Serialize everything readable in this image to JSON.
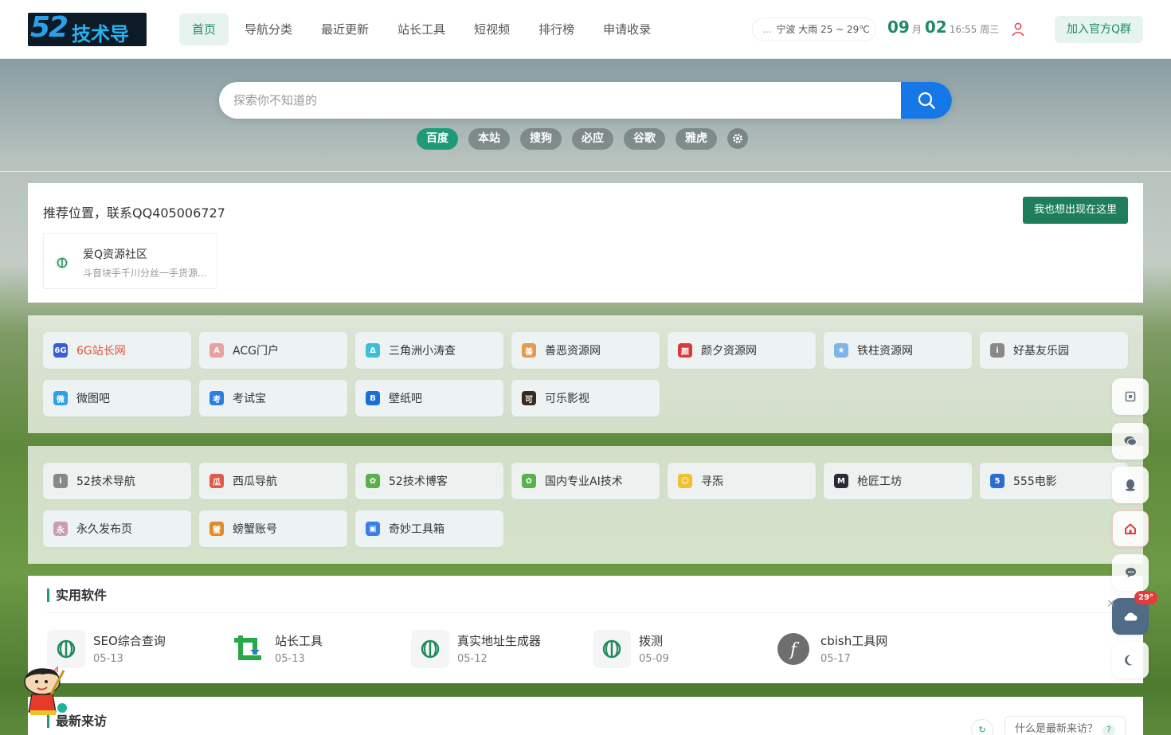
{
  "header": {
    "logo_num": "52",
    "logo_text": "技术导航",
    "nav": [
      "首页",
      "导航分类",
      "最近更新",
      "站长工具",
      "短视频",
      "排行榜",
      "申请收录"
    ],
    "weather": {
      "dots": "...",
      "text": "宁波  大雨   25 ~ 29℃"
    },
    "clock": {
      "month": "09",
      "month_unit": "月",
      "day": "02",
      "time": "16:55 周三"
    },
    "join_label": "加入官方Q群"
  },
  "search": {
    "placeholder": "探索你不知道的",
    "engines": [
      "百度",
      "本站",
      "搜狗",
      "必应",
      "谷歌",
      "雅虎"
    ]
  },
  "recommend": {
    "title": "推荐位置，联系QQ405006727",
    "button": "我也想出现在这里",
    "card": {
      "title": "爱Q资源社区",
      "desc": "斗音块手千川分丝一手货源..."
    }
  },
  "links1": [
    {
      "name": "6G站长网",
      "icon": "six-g-icon",
      "color": "#3a5fcf",
      "glyph": "6G",
      "red": true
    },
    {
      "name": "ACG门户",
      "icon": "acg-avatar-icon",
      "color": "#e8a0a0",
      "glyph": "A"
    },
    {
      "name": "三角洲小涛查",
      "icon": "delta-icon",
      "color": "#3cc0d8",
      "glyph": "Δ"
    },
    {
      "name": "善恶资源网",
      "icon": "orange-face-icon",
      "color": "#e89a4a",
      "glyph": "善"
    },
    {
      "name": "颜夕资源网",
      "icon": "red-stamp-icon",
      "color": "#d83a3a",
      "glyph": "颜"
    },
    {
      "name": "铁柱资源网",
      "icon": "blue-star-icon",
      "color": "#7fb6e8",
      "glyph": "★"
    },
    {
      "name": "好基友乐园",
      "icon": "info-circle-icon",
      "color": "#888888",
      "glyph": "i"
    },
    {
      "name": "微图吧",
      "icon": "wei-icon",
      "color": "#2ea0e8",
      "glyph": "微"
    },
    {
      "name": "考试宝",
      "icon": "exam-icon",
      "color": "#2a7fe0",
      "glyph": "考"
    },
    {
      "name": "壁纸吧",
      "icon": "wallpaper-icon",
      "color": "#1c6ed6",
      "glyph": "B"
    },
    {
      "name": "可乐影视",
      "icon": "cola-icon",
      "color": "#3a2a1a",
      "glyph": "可"
    }
  ],
  "links2": [
    {
      "name": "52技术导航",
      "icon": "info-circle-icon",
      "color": "#888888",
      "glyph": "i"
    },
    {
      "name": "西瓜导航",
      "icon": "watermelon-icon",
      "color": "#e05a4a",
      "glyph": "瓜"
    },
    {
      "name": "52技术博客",
      "icon": "cactus-icon",
      "color": "#5ab04a",
      "glyph": "✿"
    },
    {
      "name": "国内专业AI技术",
      "icon": "cactus-icon",
      "color": "#5ab04a",
      "glyph": "✿"
    },
    {
      "name": "寻炁",
      "icon": "smile-icon",
      "color": "#f0c030",
      "glyph": "☺"
    },
    {
      "name": "枪匠工坊",
      "icon": "gun-icon",
      "color": "#2a2a3a",
      "glyph": "M"
    },
    {
      "name": "555电影",
      "icon": "five-icon",
      "color": "#2a6fd0",
      "glyph": "5"
    },
    {
      "name": "永久发布页",
      "icon": "girl-avatar-icon",
      "color": "#c8a0b0",
      "glyph": "永"
    },
    {
      "name": "螃蟹账号",
      "icon": "crab-icon",
      "color": "#e08a2a",
      "glyph": "蟹"
    },
    {
      "name": "奇妙工具箱",
      "icon": "toolbox-icon",
      "color": "#3a7fe8",
      "glyph": "▣"
    }
  ],
  "software": {
    "title": "实用软件",
    "items": [
      {
        "name": "SEO综合查询",
        "date": "05-13",
        "icon": "globe-icon"
      },
      {
        "name": "站长工具",
        "date": "05-13",
        "icon": "green-crop-icon"
      },
      {
        "name": "真实地址生成器",
        "date": "05-12",
        "icon": "globe-icon"
      },
      {
        "name": "拨测",
        "date": "05-09",
        "icon": "globe-icon"
      },
      {
        "name": "cbish工具网",
        "date": "05-17",
        "icon": "f-letter-icon"
      }
    ]
  },
  "visitors": {
    "title": "最新来访",
    "refresh": "↻",
    "question": "什么是最新来访？",
    "qmark": "?"
  },
  "floatbar": {
    "badge": "29°",
    "close": "×"
  },
  "colors": {
    "accent": "#1e9a78",
    "nav_active_bg": "#e7f3ef",
    "search_btn": "#1677e6",
    "rec_btn": "#1e7d5b"
  }
}
